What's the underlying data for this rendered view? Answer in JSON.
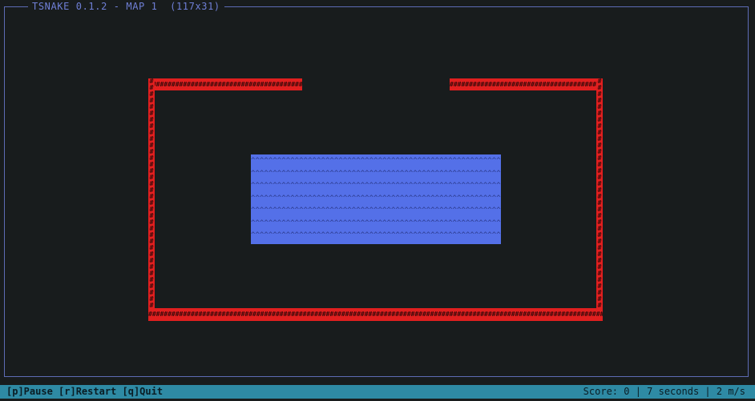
{
  "window": {
    "title": "TSNAKE 0.1.2 - MAP 1  (117x31)"
  },
  "map": {
    "wall_glyph": "#",
    "water_glyph": "^",
    "colors": {
      "background": "#181c1d",
      "wall": "#e01f1f",
      "water": "#5470e8",
      "frame": "#5d6bb5",
      "statusbar": "#2e8aa4"
    }
  },
  "statusbar": {
    "controls": "[p]Pause [r]Restart [q]Quit",
    "score": "Score: 0",
    "time": "7 seconds",
    "speed": "2 m/s"
  }
}
